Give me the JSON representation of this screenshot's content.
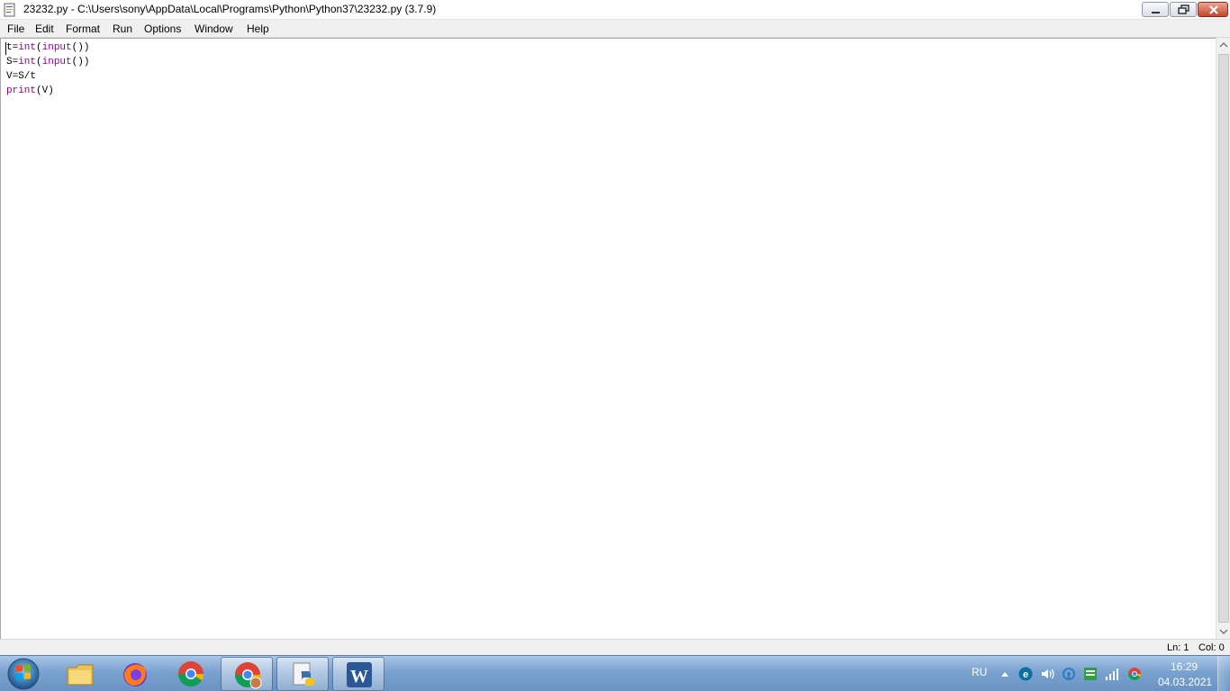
{
  "window": {
    "title": "23232.py - C:\\Users\\sony\\AppData\\Local\\Programs\\Python\\Python37\\23232.py (3.7.9)"
  },
  "menu": {
    "items": [
      "File",
      "Edit",
      "Format",
      "Run",
      "Options",
      "Window",
      "Help"
    ]
  },
  "editor": {
    "lines": [
      [
        {
          "t": "t="
        },
        {
          "t": "int",
          "k": true
        },
        {
          "t": "("
        },
        {
          "t": "input",
          "k": true
        },
        {
          "t": "())"
        }
      ],
      [
        {
          "t": "S="
        },
        {
          "t": "int",
          "k": true
        },
        {
          "t": "("
        },
        {
          "t": "input",
          "k": true
        },
        {
          "t": "())"
        }
      ],
      [
        {
          "t": "V=S/t"
        }
      ],
      [
        {
          "t": "print",
          "k": true
        },
        {
          "t": "(V)"
        }
      ]
    ]
  },
  "status": {
    "line": "Ln: 1",
    "col": "Col: 0"
  },
  "taskbar": {
    "apps": [
      "file-explorer",
      "firefox",
      "chrome",
      "chrome-user",
      "python-idle",
      "word"
    ],
    "language": "RU",
    "time": "16:29",
    "date": "04.03.2021"
  },
  "colors": {
    "keyword": "#900090",
    "taskbar": "#7aa2cf"
  }
}
